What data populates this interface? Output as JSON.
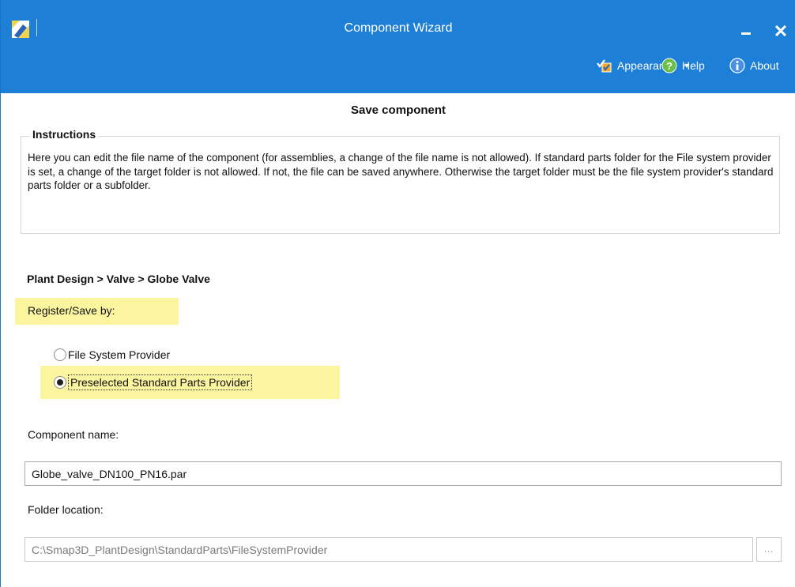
{
  "window": {
    "title": "Component Wizard",
    "accent_color": "#1e7fd6",
    "minimize_icon": "minimize-icon",
    "close_glyph": "✕"
  },
  "menu": {
    "appearance": {
      "label": "Appearance",
      "icon": "appearance-checklist-icon",
      "has_dropdown": true
    },
    "help": {
      "label": "Help",
      "icon": "help-question-icon"
    },
    "about": {
      "label": "About",
      "icon": "info-icon"
    }
  },
  "page": {
    "heading": "Save component"
  },
  "instructions": {
    "title": "Instructions",
    "text": "Here you can edit the file name of the component (for assemblies, a change of the file name is not allowed). If standard parts folder for the File system provider is set, a change of the target folder is not allowed. If not, the file can be saved anywhere. Otherwise the target folder must be the file system provider's standard parts folder or a subfolder."
  },
  "breadcrumb": "Plant Design > Valve > Globe Valve",
  "register": {
    "label": "Register/Save by:",
    "highlight_color": "#fbf5a0",
    "options": [
      {
        "label": "File System Provider",
        "checked": false
      },
      {
        "label": "Preselected Standard Parts Provider",
        "checked": true
      }
    ]
  },
  "component": {
    "label": "Component name:",
    "value": "Globe_valve_DN100_PN16.par"
  },
  "folder": {
    "label": "Folder location:",
    "value": "C:\\Smap3D_PlantDesign\\StandardParts\\FileSystemProvider",
    "disabled": true,
    "browse_label": "..."
  }
}
